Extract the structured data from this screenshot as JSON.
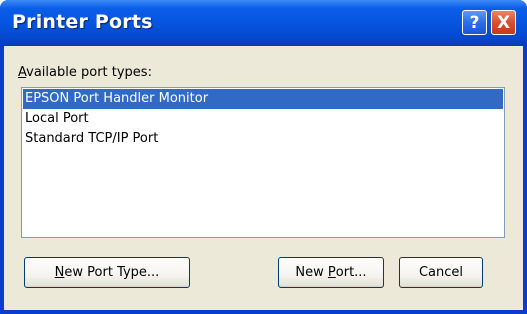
{
  "window": {
    "title": "Printer Ports",
    "help_label": "?",
    "close_label": "X"
  },
  "content": {
    "available_label_first": "A",
    "available_label_rest": "vailable port types:",
    "port_types": [
      {
        "label": "EPSON Port Handler Monitor",
        "selected": true
      },
      {
        "label": "Local Port",
        "selected": false
      },
      {
        "label": "Standard TCP/IP Port",
        "selected": false
      }
    ]
  },
  "buttons": {
    "new_port_type_first": "N",
    "new_port_type_rest": "ew Port Type...",
    "new_port_prefix": "New ",
    "new_port_mnemonic": "P",
    "new_port_rest": "ort...",
    "cancel": "Cancel"
  },
  "colors": {
    "title_bar": "#0655e0",
    "selection": "#316ac5",
    "dialog_face": "#ece9d8",
    "close_button": "#d8502f"
  }
}
